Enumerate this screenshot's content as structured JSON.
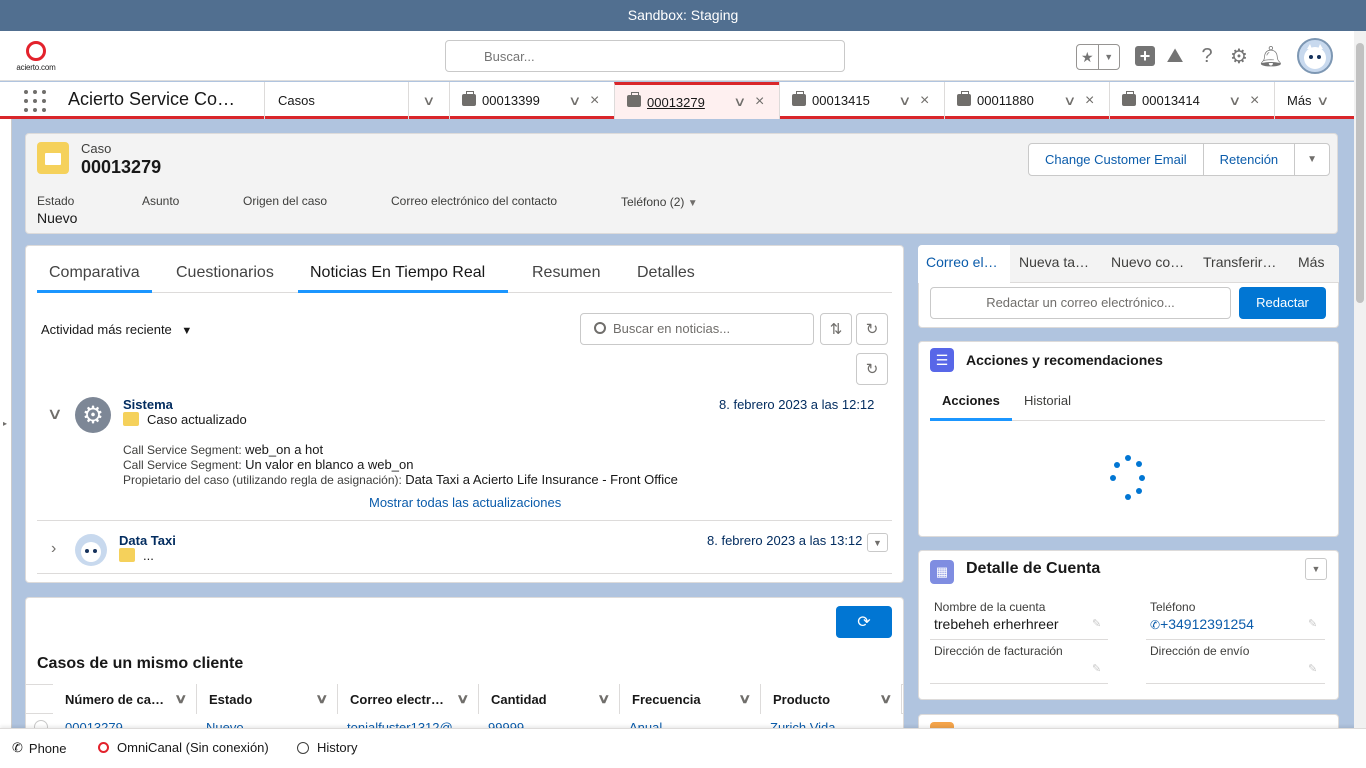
{
  "sandbox": {
    "label": "Sandbox: Staging"
  },
  "header": {
    "logo_text": "acierto.com",
    "search_placeholder": "Buscar..."
  },
  "nav": {
    "app_name": "Acierto Service Co…",
    "object_tab": "Casos",
    "tabs": [
      {
        "label": "00013399"
      },
      {
        "label": "00013279"
      },
      {
        "label": "00013415"
      },
      {
        "label": "00011880"
      },
      {
        "label": "00013414"
      }
    ],
    "more": "Más"
  },
  "case": {
    "object_label": "Caso",
    "number": "00013279",
    "buttons": [
      "Change Customer Email",
      "Retención"
    ],
    "fields": [
      {
        "label": "Estado",
        "value": "Nuevo"
      },
      {
        "label": "Asunto",
        "value": ""
      },
      {
        "label": "Origen del caso",
        "value": ""
      },
      {
        "label": "Correo electrónico del contacto",
        "value": ""
      },
      {
        "label": "Teléfono (2)",
        "value": ""
      }
    ]
  },
  "feed": {
    "tabs": [
      "Comparativa",
      "Cuestionarios",
      "Noticias En Tiempo Real",
      "Resumen",
      "Detalles"
    ],
    "sort_label": "Actividad más reciente",
    "search_placeholder": "Buscar en noticias...",
    "items": [
      {
        "author": "Sistema",
        "subtitle": "Caso actualizado",
        "date": "8. febrero 2023 a las 12:12",
        "lines": [
          {
            "label": "Call Service Segment:",
            "value": "web_on a hot"
          },
          {
            "label": "Call Service Segment:",
            "value": "Un valor en blanco a web_on"
          },
          {
            "label": "Propietario del caso (utilizando regla de asignación):",
            "value": "Data Taxi a Acierto Life Insurance - Front Office"
          }
        ],
        "show_all": "Mostrar todas las actualizaciones"
      },
      {
        "author": "Data Taxi",
        "subtitle": "...",
        "date": "8. febrero 2023 a las 13:12"
      }
    ]
  },
  "email": {
    "tabs": [
      "Correo el…",
      "Nueva ta…",
      "Nuevo co…",
      "Transferir…",
      "Más"
    ],
    "placeholder": "Redactar un correo electrónico...",
    "button": "Redactar"
  },
  "actions": {
    "title": "Acciones y recomendaciones",
    "tabs": [
      "Acciones",
      "Historial"
    ]
  },
  "account": {
    "title": "Detalle de Cuenta",
    "fields": [
      {
        "label": "Nombre de la cuenta",
        "value": "trebeheh erherhreer"
      },
      {
        "label": "Teléfono",
        "value": "+34912391254"
      },
      {
        "label": "Dirección de facturación",
        "value": ""
      },
      {
        "label": "Dirección de envío",
        "value": ""
      }
    ]
  },
  "cases": {
    "title": "Casos de un mismo cliente",
    "columns": [
      "Número de ca…",
      "Estado",
      "Correo electr…",
      "Cantidad",
      "Frecuencia",
      "Producto"
    ],
    "row": [
      "00013279",
      "Nuevo",
      "tonialfuster1312@...",
      "99999",
      "Anual",
      "Zurich Vida"
    ]
  },
  "utility": {
    "items": [
      "Phone",
      "OmniCanal (Sin conexión)",
      "History"
    ]
  },
  "colors": {
    "accent": "#0176d3",
    "brand_red": "#d9262a",
    "sandbox_bar": "#516f90",
    "background": "#b0c4df"
  }
}
